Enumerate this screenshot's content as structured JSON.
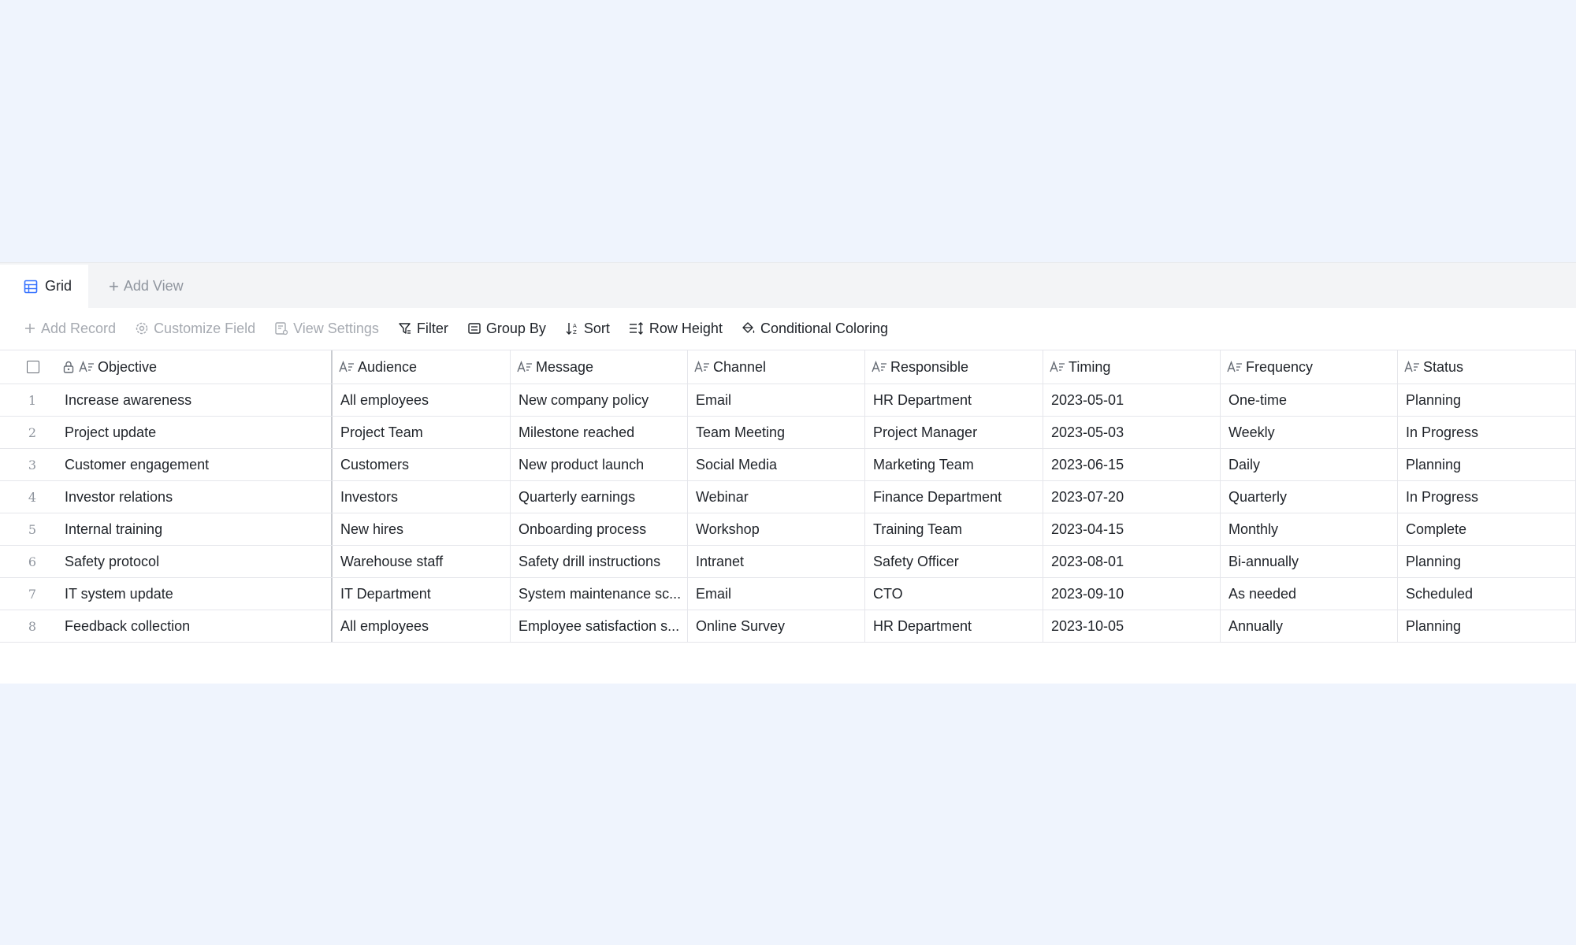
{
  "tabs": {
    "grid_label": "Grid",
    "add_view_label": "Add View"
  },
  "toolbar": {
    "add_record": "Add Record",
    "customize_field": "Customize Field",
    "view_settings": "View Settings",
    "filter": "Filter",
    "group_by": "Group By",
    "sort": "Sort",
    "row_height": "Row Height",
    "conditional_coloring": "Conditional Coloring"
  },
  "columns": [
    "Objective",
    "Audience",
    "Message",
    "Channel",
    "Responsible",
    "Timing",
    "Frequency",
    "Status"
  ],
  "rows": [
    {
      "num": "1",
      "cells": [
        "Increase awareness",
        "All employees",
        "New company policy",
        "Email",
        "HR Department",
        "2023-05-01",
        "One-time",
        "Planning"
      ]
    },
    {
      "num": "2",
      "cells": [
        "Project update",
        "Project Team",
        "Milestone reached",
        "Team Meeting",
        "Project Manager",
        "2023-05-03",
        "Weekly",
        "In Progress"
      ]
    },
    {
      "num": "3",
      "cells": [
        "Customer engagement",
        "Customers",
        "New product launch",
        "Social Media",
        "Marketing Team",
        "2023-06-15",
        "Daily",
        "Planning"
      ]
    },
    {
      "num": "4",
      "cells": [
        "Investor relations",
        "Investors",
        "Quarterly earnings",
        "Webinar",
        "Finance Department",
        "2023-07-20",
        "Quarterly",
        "In Progress"
      ]
    },
    {
      "num": "5",
      "cells": [
        "Internal training",
        "New hires",
        "Onboarding process",
        "Workshop",
        "Training Team",
        "2023-04-15",
        "Monthly",
        "Complete"
      ]
    },
    {
      "num": "6",
      "cells": [
        "Safety protocol",
        "Warehouse staff",
        "Safety drill instructions",
        "Intranet",
        "Safety Officer",
        "2023-08-01",
        "Bi-annually",
        "Planning"
      ]
    },
    {
      "num": "7",
      "cells": [
        "IT system update",
        "IT Department",
        "System maintenance sc...",
        "Email",
        "CTO",
        "2023-09-10",
        "As needed",
        "Scheduled"
      ]
    },
    {
      "num": "8",
      "cells": [
        "Feedback collection",
        "All employees",
        "Employee satisfaction s...",
        "Online Survey",
        "HR Department",
        "2023-10-05",
        "Annually",
        "Planning"
      ]
    }
  ],
  "colors": {
    "page_bg": "#eff4fd",
    "accent": "#3370ff",
    "disabled_text": "#a6aab1",
    "row_number": "#8f959e"
  }
}
